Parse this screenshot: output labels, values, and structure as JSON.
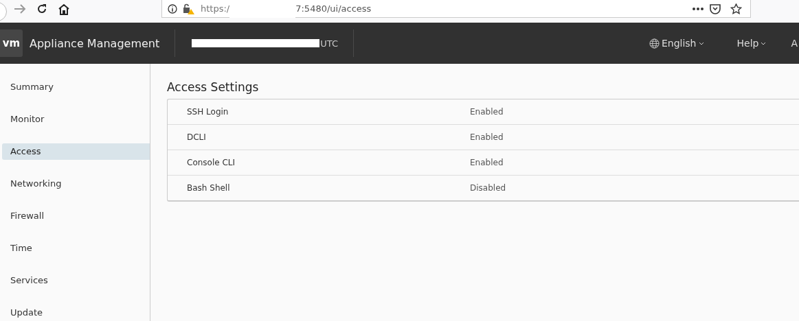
{
  "browser": {
    "url_start": "https:/",
    "url_end": "7:5480/ui/access"
  },
  "header": {
    "logo": "vm",
    "title": "Appliance Management",
    "datetime": "UTC",
    "menus": [
      {
        "label": "English",
        "kind": "language"
      },
      {
        "label": "Help",
        "kind": "plain"
      },
      {
        "label": "A",
        "kind": "cut"
      }
    ]
  },
  "sidebar": {
    "items": [
      {
        "label": "Summary",
        "selected": false
      },
      {
        "label": "Monitor",
        "selected": false
      },
      {
        "label": "Access",
        "selected": true
      },
      {
        "label": "Networking",
        "selected": false
      },
      {
        "label": "Firewall",
        "selected": false
      },
      {
        "label": "Time",
        "selected": false
      },
      {
        "label": "Services",
        "selected": false
      },
      {
        "label": "Update",
        "selected": false
      }
    ]
  },
  "main": {
    "title": "Access Settings",
    "rows": [
      {
        "name": "SSH Login",
        "status": "Enabled"
      },
      {
        "name": "DCLI",
        "status": "Enabled"
      },
      {
        "name": "Console CLI",
        "status": "Enabled"
      },
      {
        "name": "Bash Shell",
        "status": "Disabled"
      }
    ]
  }
}
